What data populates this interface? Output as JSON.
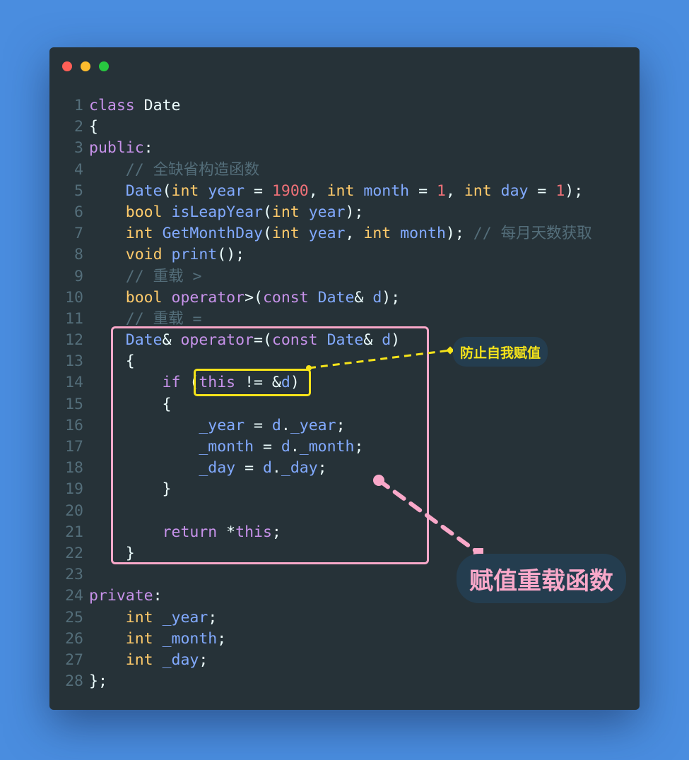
{
  "window": {
    "controls": [
      {
        "name": "close",
        "color": "#ff5f57"
      },
      {
        "name": "minimize",
        "color": "#febc2e"
      },
      {
        "name": "maximize",
        "color": "#28c840"
      }
    ]
  },
  "code": {
    "language": "cpp",
    "lines": [
      {
        "n": "1",
        "tokens": [
          [
            "kw",
            "class"
          ],
          [
            "pl",
            " Date"
          ]
        ]
      },
      {
        "n": "2",
        "tokens": [
          [
            "pl",
            "{"
          ]
        ]
      },
      {
        "n": "3",
        "tokens": [
          [
            "kw",
            "public"
          ],
          [
            "pl",
            ":"
          ]
        ]
      },
      {
        "n": "4",
        "tokens": [
          [
            "pl",
            "    "
          ],
          [
            "cm",
            "// 全缺省构造函数"
          ]
        ]
      },
      {
        "n": "5",
        "tokens": [
          [
            "pl",
            "    "
          ],
          [
            "cl",
            "Date"
          ],
          [
            "pl",
            "("
          ],
          [
            "ty",
            "int"
          ],
          [
            "pl",
            " "
          ],
          [
            "cl",
            "year"
          ],
          [
            "pl",
            " = "
          ],
          [
            "nm",
            "1900"
          ],
          [
            "pl",
            ", "
          ],
          [
            "ty",
            "int"
          ],
          [
            "pl",
            " "
          ],
          [
            "cl",
            "month"
          ],
          [
            "pl",
            " = "
          ],
          [
            "nm",
            "1"
          ],
          [
            "pl",
            ", "
          ],
          [
            "ty",
            "int"
          ],
          [
            "pl",
            " "
          ],
          [
            "cl",
            "day"
          ],
          [
            "pl",
            " = "
          ],
          [
            "nm",
            "1"
          ],
          [
            "pl",
            ");"
          ]
        ]
      },
      {
        "n": "6",
        "tokens": [
          [
            "pl",
            "    "
          ],
          [
            "ty",
            "bool"
          ],
          [
            "pl",
            " "
          ],
          [
            "cl",
            "isLeapYear"
          ],
          [
            "pl",
            "("
          ],
          [
            "ty",
            "int"
          ],
          [
            "pl",
            " "
          ],
          [
            "cl",
            "year"
          ],
          [
            "pl",
            ");"
          ]
        ]
      },
      {
        "n": "7",
        "tokens": [
          [
            "pl",
            "    "
          ],
          [
            "ty",
            "int"
          ],
          [
            "pl",
            " "
          ],
          [
            "cl",
            "GetMonthDay"
          ],
          [
            "pl",
            "("
          ],
          [
            "ty",
            "int"
          ],
          [
            "pl",
            " "
          ],
          [
            "cl",
            "year"
          ],
          [
            "pl",
            ", "
          ],
          [
            "ty",
            "int"
          ],
          [
            "pl",
            " "
          ],
          [
            "cl",
            "month"
          ],
          [
            "pl",
            "); "
          ],
          [
            "cm",
            "// 每月天数获取"
          ]
        ]
      },
      {
        "n": "8",
        "tokens": [
          [
            "pl",
            "    "
          ],
          [
            "ty",
            "void"
          ],
          [
            "pl",
            " "
          ],
          [
            "cl",
            "print"
          ],
          [
            "pl",
            "();"
          ]
        ]
      },
      {
        "n": "9",
        "tokens": [
          [
            "pl",
            "    "
          ],
          [
            "cm",
            "// 重载 >"
          ]
        ]
      },
      {
        "n": "10",
        "tokens": [
          [
            "pl",
            "    "
          ],
          [
            "ty",
            "bool"
          ],
          [
            "pl",
            " "
          ],
          [
            "kw",
            "operator"
          ],
          [
            "pl",
            ">("
          ],
          [
            "kw",
            "const"
          ],
          [
            "pl",
            " "
          ],
          [
            "cl",
            "Date"
          ],
          [
            "pl",
            "& "
          ],
          [
            "cl",
            "d"
          ],
          [
            "pl",
            ");"
          ]
        ]
      },
      {
        "n": "11",
        "tokens": [
          [
            "pl",
            "    "
          ],
          [
            "cm",
            "// 重载 ="
          ]
        ]
      },
      {
        "n": "12",
        "tokens": [
          [
            "pl",
            "    "
          ],
          [
            "cl",
            "Date"
          ],
          [
            "pl",
            "& "
          ],
          [
            "kw",
            "operator"
          ],
          [
            "pl",
            "=("
          ],
          [
            "kw",
            "const"
          ],
          [
            "pl",
            " "
          ],
          [
            "cl",
            "Date"
          ],
          [
            "pl",
            "& "
          ],
          [
            "cl",
            "d"
          ],
          [
            "pl",
            ")"
          ]
        ]
      },
      {
        "n": "13",
        "tokens": [
          [
            "pl",
            "    {"
          ]
        ]
      },
      {
        "n": "14",
        "tokens": [
          [
            "pl",
            "        "
          ],
          [
            "kw",
            "if"
          ],
          [
            "pl",
            " ("
          ],
          [
            "kw",
            "this"
          ],
          [
            "pl",
            " != &"
          ],
          [
            "cl",
            "d"
          ],
          [
            "pl",
            ")"
          ]
        ]
      },
      {
        "n": "15",
        "tokens": [
          [
            "pl",
            "        {"
          ]
        ]
      },
      {
        "n": "16",
        "tokens": [
          [
            "pl",
            "            "
          ],
          [
            "cl",
            "_year"
          ],
          [
            "pl",
            " = "
          ],
          [
            "cl",
            "d"
          ],
          [
            "pl",
            "."
          ],
          [
            "cl",
            "_year"
          ],
          [
            "pl",
            ";"
          ]
        ]
      },
      {
        "n": "17",
        "tokens": [
          [
            "pl",
            "            "
          ],
          [
            "cl",
            "_month"
          ],
          [
            "pl",
            " = "
          ],
          [
            "cl",
            "d"
          ],
          [
            "pl",
            "."
          ],
          [
            "cl",
            "_month"
          ],
          [
            "pl",
            ";"
          ]
        ]
      },
      {
        "n": "18",
        "tokens": [
          [
            "pl",
            "            "
          ],
          [
            "cl",
            "_day"
          ],
          [
            "pl",
            " = "
          ],
          [
            "cl",
            "d"
          ],
          [
            "pl",
            "."
          ],
          [
            "cl",
            "_day"
          ],
          [
            "pl",
            ";"
          ]
        ]
      },
      {
        "n": "19",
        "tokens": [
          [
            "pl",
            "        }"
          ]
        ]
      },
      {
        "n": "20",
        "tokens": [
          [
            "pl",
            ""
          ]
        ]
      },
      {
        "n": "21",
        "tokens": [
          [
            "pl",
            "        "
          ],
          [
            "kw",
            "return"
          ],
          [
            "pl",
            " *"
          ],
          [
            "kw",
            "this"
          ],
          [
            "pl",
            ";"
          ]
        ]
      },
      {
        "n": "22",
        "tokens": [
          [
            "pl",
            "    }"
          ]
        ]
      },
      {
        "n": "23",
        "tokens": [
          [
            "pl",
            ""
          ]
        ]
      },
      {
        "n": "24",
        "tokens": [
          [
            "kw",
            "private"
          ],
          [
            "pl",
            ":"
          ]
        ]
      },
      {
        "n": "25",
        "tokens": [
          [
            "pl",
            "    "
          ],
          [
            "ty",
            "int"
          ],
          [
            "pl",
            " "
          ],
          [
            "cl",
            "_year"
          ],
          [
            "pl",
            ";"
          ]
        ]
      },
      {
        "n": "26",
        "tokens": [
          [
            "pl",
            "    "
          ],
          [
            "ty",
            "int"
          ],
          [
            "pl",
            " "
          ],
          [
            "cl",
            "_month"
          ],
          [
            "pl",
            ";"
          ]
        ]
      },
      {
        "n": "27",
        "tokens": [
          [
            "pl",
            "    "
          ],
          [
            "ty",
            "int"
          ],
          [
            "pl",
            " "
          ],
          [
            "cl",
            "_day"
          ],
          [
            "pl",
            ";"
          ]
        ]
      },
      {
        "n": "28",
        "tokens": [
          [
            "pl",
            "};"
          ]
        ]
      }
    ]
  },
  "annotations": {
    "self_assign_label": "防止自我赋值",
    "self_assign_color": "#f5e31a",
    "assign_overload_label": "赋值重载函数",
    "assign_overload_color": "#f9a8c9"
  }
}
